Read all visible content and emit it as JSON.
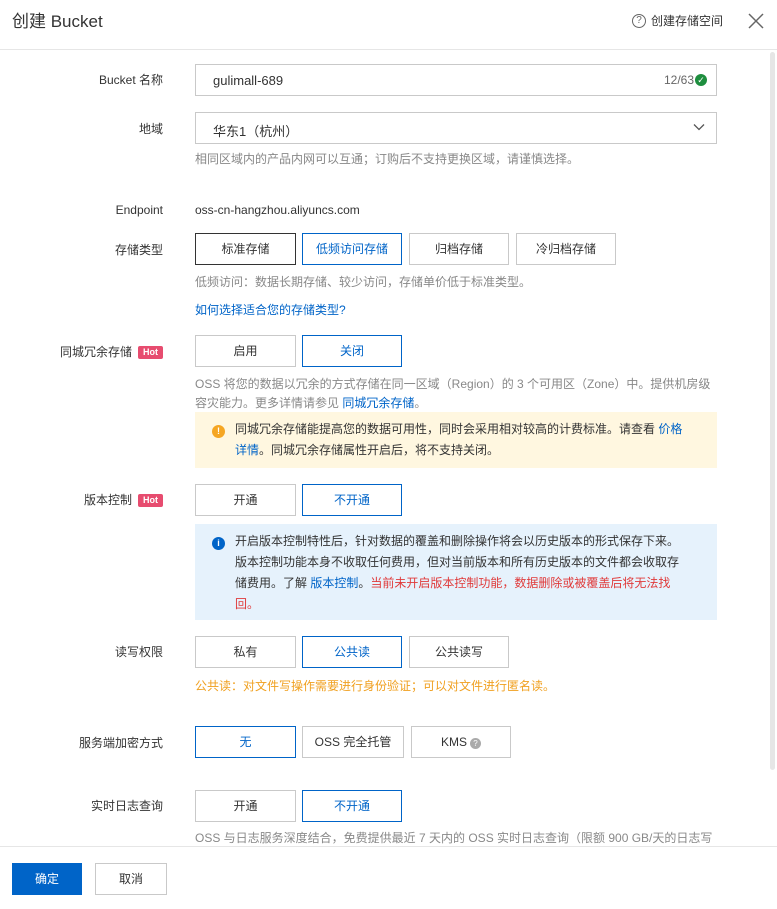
{
  "header": {
    "title": "创建 Bucket",
    "help_label": "创建存储空间"
  },
  "bucket_name": {
    "label": "Bucket 名称",
    "value": "gulimall-689",
    "counter": "12/63"
  },
  "region": {
    "label": "地域",
    "value": "华东1（杭州）",
    "help": "相同区域内的产品内网可以互通；订购后不支持更换区域，请谨慎选择。"
  },
  "endpoint": {
    "label": "Endpoint",
    "value": "oss-cn-hangzhou.aliyuncs.com"
  },
  "storage_class": {
    "label": "存储类型",
    "options": [
      "标准存储",
      "低频访问存储",
      "归档存储",
      "冷归档存储"
    ],
    "help": "低频访问：数据长期存储、较少访问，存储单价低于标准类型。",
    "link": "如何选择适合您的存储类型?"
  },
  "zrs": {
    "label": "同城冗余存储",
    "hot": "Hot",
    "options": [
      "启用",
      "关闭"
    ],
    "help_line1": "OSS 将您的数据以冗余的方式存储在同一区域（Region）的 3 个可用区（Zone）中。提供机房级",
    "help_line2": "容灾能力。更多详情请参见 ",
    "help_link": "同城冗余存储",
    "help_end": "。",
    "alert_line1": "同城冗余存储能提高您的数据可用性，同时会采用相对较高的计费标准。请查看 ",
    "alert_link1": "价格",
    "alert_link2": "详情",
    "alert_line2": "。同城冗余存储属性开启后，将不支持关闭。"
  },
  "versioning": {
    "label": "版本控制",
    "hot": "Hot",
    "options": [
      "开通",
      "不开通"
    ],
    "info_line1": "开启版本控制特性后，针对数据的覆盖和删除操作将会以历史版本的形式保存下来。",
    "info_line2": "版本控制功能本身不收取任何费用，但对当前版本和所有历史版本的文件都会收取存",
    "info_line3a": "储费用。了解 ",
    "info_link": "版本控制",
    "info_line3b": "。",
    "info_red1": "当前未开启版本控制功能，数据删除或被覆盖后将无法找",
    "info_red2": "回。"
  },
  "acl": {
    "label": "读写权限",
    "options": [
      "私有",
      "公共读",
      "公共读写"
    ],
    "warn": "公共读：对文件写操作需要进行身份验证；可以对文件进行匿名读。"
  },
  "encryption": {
    "label": "服务端加密方式",
    "options": [
      "无",
      "OSS 完全托管",
      "KMS"
    ]
  },
  "realtime_log": {
    "label": "实时日志查询",
    "options": [
      "开通",
      "不开通"
    ],
    "help": "OSS 与日志服务深度结合，免费提供最近 7 天内的 OSS 实时日志查询（限额 900 GB/天的日志写"
  },
  "footer": {
    "confirm": "确定",
    "cancel": "取消"
  },
  "colors": {
    "primary": "#0064c8",
    "hot": "#e74c6f",
    "warn_bg": "#fff7e0",
    "info_bg": "#e6f2fc",
    "danger": "#e03a3a",
    "warn_text": "#f0a020"
  }
}
